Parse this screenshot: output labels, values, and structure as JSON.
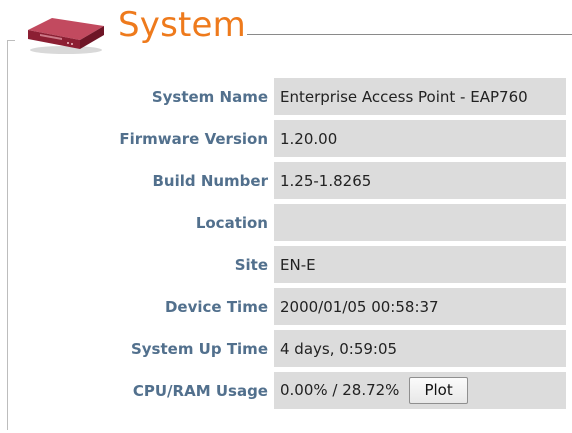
{
  "section": {
    "title": "System",
    "icon": "router-device-icon",
    "accent_color": "#ee7a1c",
    "label_color": "#52708d",
    "value_bg": "#dcdcdc"
  },
  "rows": [
    {
      "label": "System Name",
      "value": "Enterprise Access Point - EAP760"
    },
    {
      "label": "Firmware Version",
      "value": "1.20.00"
    },
    {
      "label": "Build Number",
      "value": "1.25-1.8265"
    },
    {
      "label": "Location",
      "value": ""
    },
    {
      "label": "Site",
      "value": "EN-E"
    },
    {
      "label": "Device Time",
      "value": "2000/01/05 00:58:37"
    },
    {
      "label": "System Up Time",
      "value": "4 days, 0:59:05"
    },
    {
      "label": "CPU/RAM Usage",
      "value": "0.00% / 28.72%"
    }
  ],
  "plot_button_label": "Plot"
}
